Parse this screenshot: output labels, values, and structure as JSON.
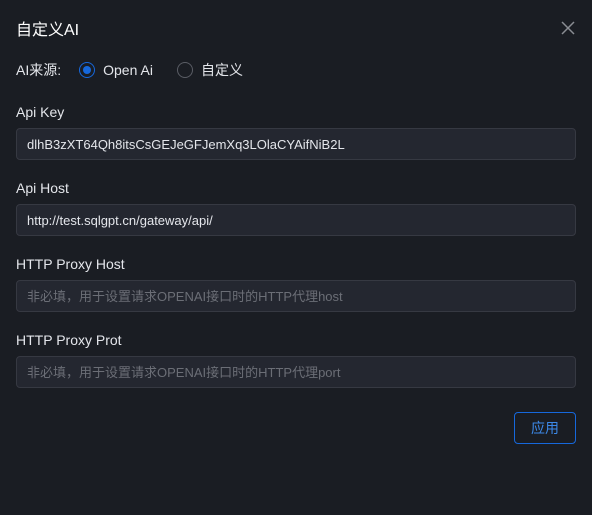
{
  "modal": {
    "title": "自定义AI"
  },
  "source": {
    "label": "AI来源:",
    "options": [
      {
        "label": "Open Ai",
        "checked": true
      },
      {
        "label": "自定义",
        "checked": false
      }
    ]
  },
  "fields": {
    "apiKey": {
      "label": "Api Key",
      "value": "dlhB3zXT64Qh8itsCsGEJeGFJemXq3LOlaCYAifNiB2L"
    },
    "apiHost": {
      "label": "Api Host",
      "value": "http://test.sqlgpt.cn/gateway/api/"
    },
    "httpProxyHost": {
      "label": "HTTP Proxy Host",
      "value": "",
      "placeholder": "非必填，用于设置请求OPENAI接口时的HTTP代理host"
    },
    "httpProxyPort": {
      "label": "HTTP Proxy Prot",
      "value": "",
      "placeholder": "非必填，用于设置请求OPENAI接口时的HTTP代理port"
    }
  },
  "footer": {
    "applyLabel": "应用"
  }
}
